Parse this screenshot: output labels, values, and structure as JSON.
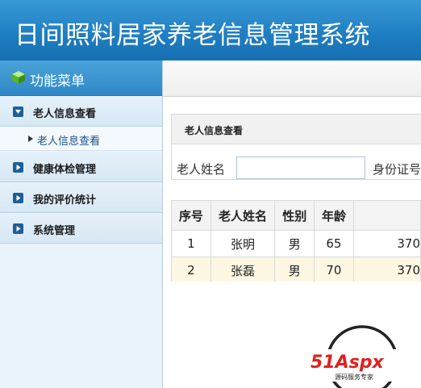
{
  "app": {
    "title": "日间照料居家养老信息管理系统"
  },
  "sidebar": {
    "menu_title": "功能菜单",
    "items": [
      {
        "label": "老人信息查看"
      },
      {
        "label": "健康体检管理"
      },
      {
        "label": "我的评价统计"
      },
      {
        "label": "系统管理"
      }
    ],
    "sub_items": [
      {
        "label": "老人信息查看"
      }
    ]
  },
  "panel": {
    "title": "老人信息查看",
    "name_label": "老人姓名",
    "name_value": "",
    "id_label": "身份证号"
  },
  "table": {
    "headers": [
      "序号",
      "老人姓名",
      "性别",
      "年龄",
      ""
    ],
    "rows": [
      [
        "1",
        "张明",
        "男",
        "65",
        "370"
      ],
      [
        "2",
        "张磊",
        "男",
        "70",
        "370"
      ]
    ]
  },
  "watermark": {
    "main": "51Aspx",
    "sub": "源码服务专家"
  },
  "colors": {
    "header": "#1f7fc2",
    "accent": "#1e5f96",
    "row_alt": "#fdf7e3"
  }
}
